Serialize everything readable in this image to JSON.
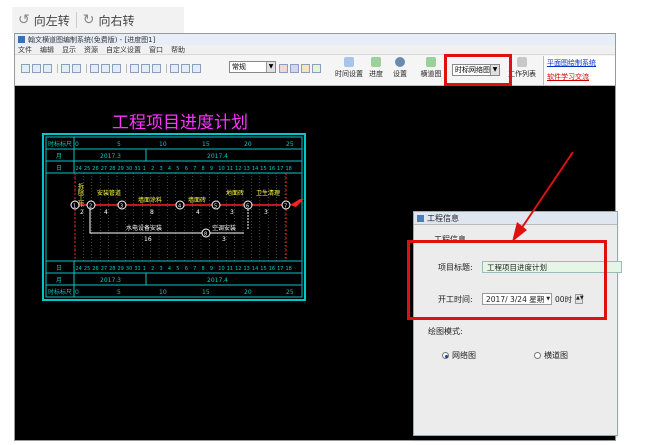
{
  "rotate": {
    "left_label": "向左转",
    "right_label": "向右转"
  },
  "window": {
    "title": "翰文横道图编制系统(免费版) - [进度图1]",
    "menus": [
      "文件",
      "编辑",
      "显示",
      "资源",
      "自定义设置",
      "窗口",
      "帮助"
    ]
  },
  "toolbar": {
    "style_select": "常规",
    "buttons": [
      "时间设置",
      "进度",
      "设置",
      "横道图"
    ],
    "view_select": "时标网络图",
    "work_list": "工作列表",
    "links": [
      "平面图绘制系统",
      "软件学习交流"
    ]
  },
  "chart": {
    "title": "工程项目进度计划",
    "ruler_label": "时标标尺",
    "month_label": "月",
    "day_label": "日",
    "month_top": [
      "2017.3",
      "2017.4"
    ],
    "day_ticks_top": [
      "0",
      "5",
      "10",
      "15",
      "20",
      "25"
    ],
    "days": [
      "24",
      "25",
      "26",
      "27",
      "28",
      "29",
      "30",
      "31",
      "1",
      "2",
      "3",
      "4",
      "5",
      "6",
      "7",
      "8",
      "9",
      "10",
      "11",
      "12",
      "13",
      "14",
      "15",
      "16",
      "17",
      "18"
    ],
    "tasks": [
      {
        "name": "拆除工作",
        "duration": "2"
      },
      {
        "name": "安装管道",
        "duration": "4"
      },
      {
        "name": "墙面涂料",
        "duration": "8"
      },
      {
        "name": "墙面砖",
        "duration": "4"
      },
      {
        "name": "地面砖",
        "duration": "3"
      },
      {
        "name": "卫生清理",
        "duration": "3"
      },
      {
        "name": "水电设备安装",
        "duration": "16"
      },
      {
        "name": "空调安装",
        "duration": "3"
      }
    ],
    "nodes": [
      "1",
      "2",
      "3",
      "4",
      "5",
      "6",
      "7",
      "8"
    ]
  },
  "dialog": {
    "title": "工程信息",
    "section": "工程信息",
    "project_title_label": "项目标题:",
    "project_title_value": "工程项目进度计划",
    "start_time_label": "开工时间:",
    "start_date": "2017/ 3/24 星期",
    "start_hour": "00时",
    "mode_label": "绘图模式:",
    "modes": [
      {
        "label": "网络图",
        "selected": true
      },
      {
        "label": "横道图",
        "selected": false
      }
    ]
  },
  "colors": {
    "highlight": "#e01010",
    "chart_frame": "#00c8c8",
    "chart_title": "#ff33ff",
    "task_red": "#ff2020"
  }
}
